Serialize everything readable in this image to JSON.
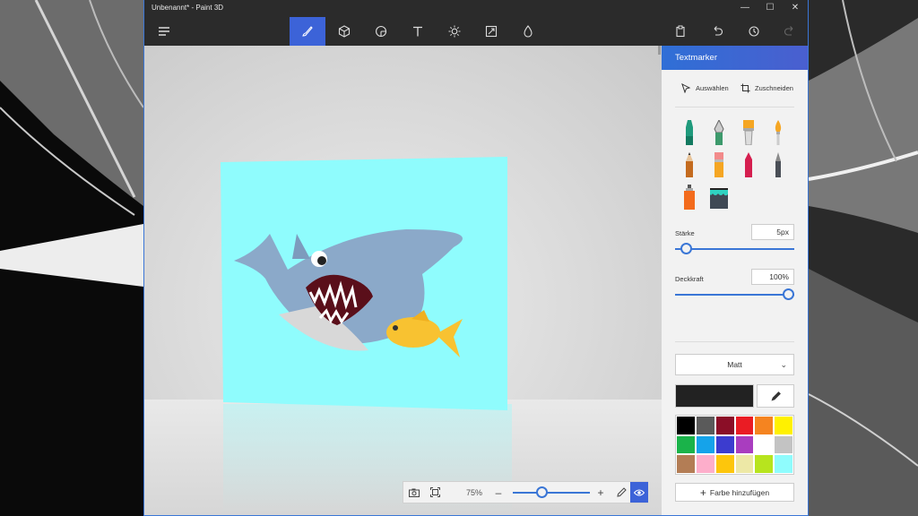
{
  "window": {
    "title": "Unbenannt* - Paint 3D"
  },
  "window_controls": {
    "minimize": "—",
    "maximize": "☐",
    "close": "✕"
  },
  "toolbar": {
    "tools": [
      {
        "icon": "brush-icon",
        "active": true
      },
      {
        "icon": "cube-icon",
        "active": false
      },
      {
        "icon": "sticker-icon",
        "active": false
      },
      {
        "icon": "text-icon",
        "active": false
      },
      {
        "icon": "effects-sun-icon",
        "active": false
      },
      {
        "icon": "canvas-resize-icon",
        "active": false
      },
      {
        "icon": "remix-3d-icon",
        "active": false
      }
    ],
    "right": [
      "paste-icon",
      "undo-icon",
      "history-icon",
      "redo-icon"
    ],
    "accent_color": "#3c63d8"
  },
  "canvas": {
    "background_color": "#8ffcfd"
  },
  "zoombar": {
    "zoom_value": "75%",
    "zoom_level": 0.35,
    "minus": "–",
    "plus": "+"
  },
  "panel": {
    "title": "Textmarker",
    "select_label": "Auswählen",
    "crop_label": "Zuschneiden",
    "brushes": [
      "marker",
      "calligraphy-pen",
      "oil-brush",
      "watercolor",
      "pencil",
      "eraser",
      "crayon",
      "pixel-pen",
      "spray-can",
      "fill-bucket"
    ],
    "thickness_label": "Stärke",
    "thickness_value": "5px",
    "thickness_level": 0.05,
    "opacity_label": "Deckkraft",
    "opacity_value": "100%",
    "opacity_level": 1.0,
    "finish_value": "Matt",
    "current_color": "#222222",
    "palette": [
      "#000000",
      "#5a5a5a",
      "#8b0e27",
      "#ea1c24",
      "#f58420",
      "#fff100",
      "#1ab34a",
      "#15a3ea",
      "#3c3ccf",
      "#a93dbf",
      "#ffffff",
      "#c3c3c3",
      "#b37d55",
      "#fdaecb",
      "#fdc60c",
      "#ede8a6",
      "#b7e41e",
      "#8ffcfd"
    ],
    "add_color_label": "Farbe hinzufügen"
  }
}
